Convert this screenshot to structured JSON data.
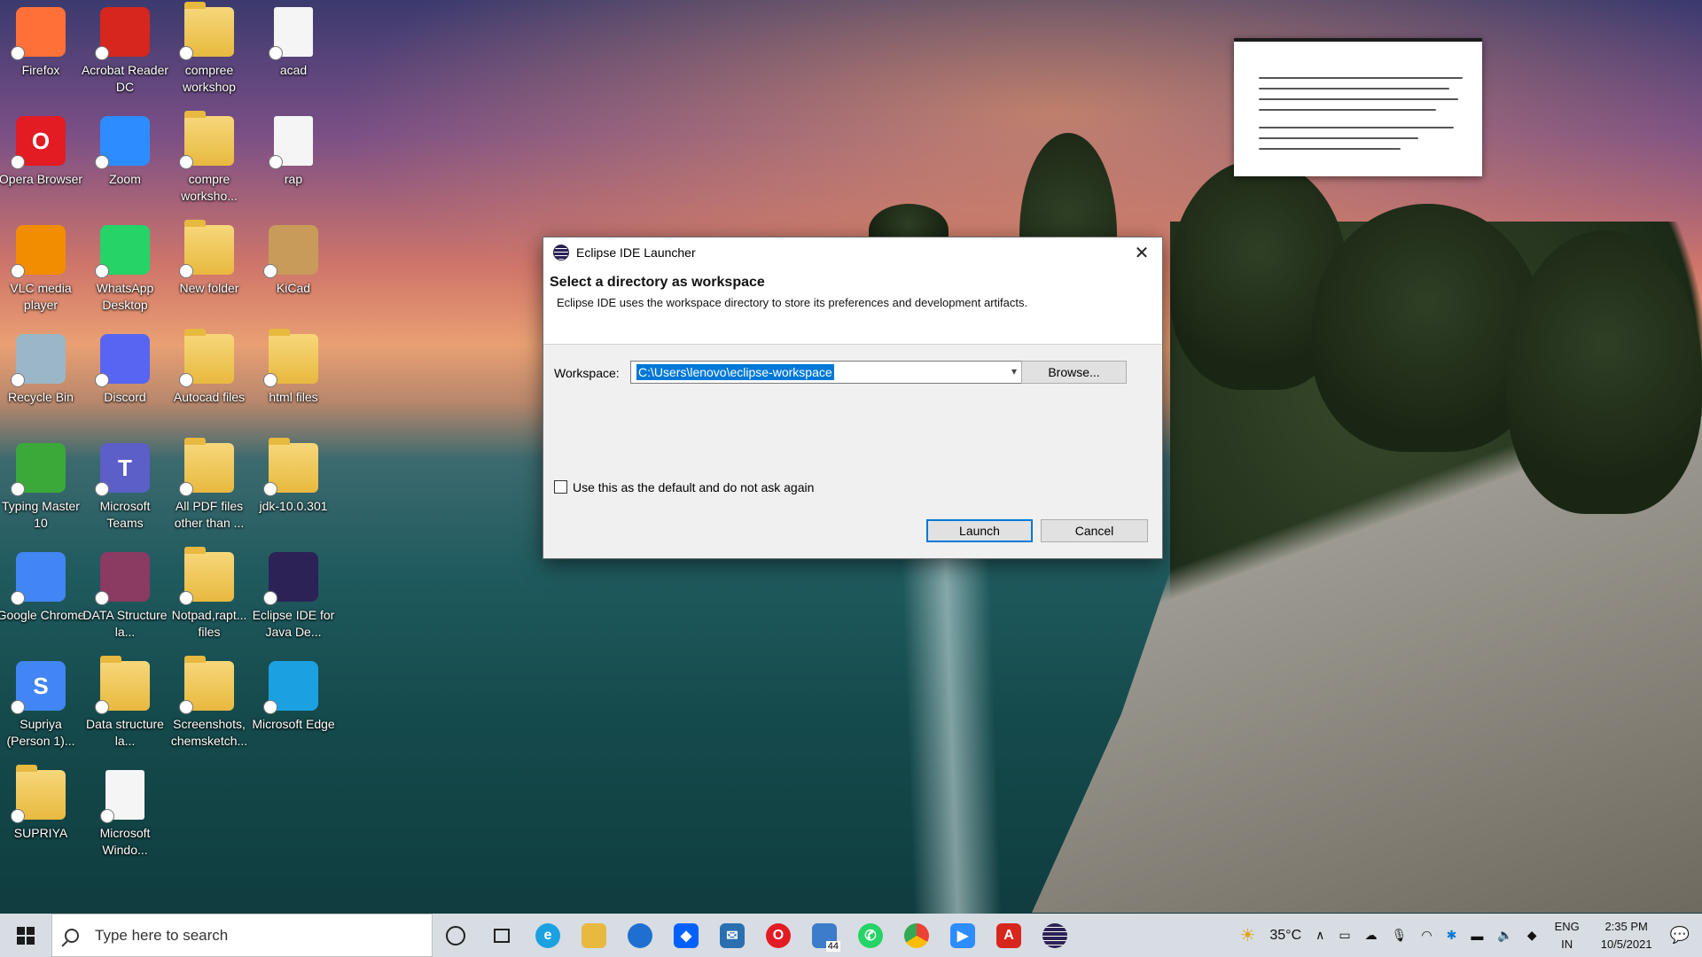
{
  "desktop": {
    "icons": [
      {
        "label": "Firefox",
        "glyph": "",
        "color": "#ff7139"
      },
      {
        "label": "Acrobat Reader DC",
        "glyph": "",
        "color": "#d7261e"
      },
      {
        "label": "compree workshop",
        "glyph": "",
        "color": "folder"
      },
      {
        "label": "acad",
        "glyph": "",
        "color": "doc"
      },
      {
        "label": "Opera Browser",
        "glyph": "O",
        "color": "#e31b23"
      },
      {
        "label": "Zoom",
        "glyph": "",
        "color": "#2d8cff"
      },
      {
        "label": "compre worksho...",
        "glyph": "",
        "color": "folder"
      },
      {
        "label": "rap",
        "glyph": "",
        "color": "doc"
      },
      {
        "label": "VLC media player",
        "glyph": "",
        "color": "#f28c00"
      },
      {
        "label": "WhatsApp Desktop",
        "glyph": "",
        "color": "#25d366"
      },
      {
        "label": "New folder",
        "glyph": "",
        "color": "folder"
      },
      {
        "label": "KiCad",
        "glyph": "",
        "color": "#c89b5a"
      },
      {
        "label": "Recycle Bin",
        "glyph": "",
        "color": "#9bb7c7"
      },
      {
        "label": "Discord",
        "glyph": "",
        "color": "#5865f2"
      },
      {
        "label": "Autocad files",
        "glyph": "",
        "color": "folder"
      },
      {
        "label": "html files",
        "glyph": "",
        "color": "folder"
      },
      {
        "label": "Typing Master 10",
        "glyph": "",
        "color": "#3aa93a"
      },
      {
        "label": "Microsoft Teams",
        "glyph": "T",
        "color": "#5b5fc7"
      },
      {
        "label": "All PDF files other than ...",
        "glyph": "",
        "color": "folder"
      },
      {
        "label": "jdk-10.0.301",
        "glyph": "",
        "color": "folder"
      },
      {
        "label": "Google Chrome",
        "glyph": "",
        "color": "#4285f4"
      },
      {
        "label": "DATA Structure la...",
        "glyph": "",
        "color": "#8b3a62"
      },
      {
        "label": "Notpad,rapt... files",
        "glyph": "",
        "color": "folder"
      },
      {
        "label": "Eclipse IDE for Java De...",
        "glyph": "",
        "color": "#2c2255"
      },
      {
        "label": "Supriya (Person 1)...",
        "glyph": "S",
        "color": "#4285f4"
      },
      {
        "label": "Data structure la...",
        "glyph": "",
        "color": "folder"
      },
      {
        "label": "Screenshots, chemsketch...",
        "glyph": "",
        "color": "folder"
      },
      {
        "label": "Microsoft Edge",
        "glyph": "",
        "color": "#1ba1e2"
      },
      {
        "label": "SUPRIYA",
        "glyph": "",
        "color": "folder"
      },
      {
        "label": "Microsoft Windo...",
        "glyph": "",
        "color": "doc"
      }
    ]
  },
  "dialog": {
    "title": "Eclipse IDE Launcher",
    "heading": "Select a directory as workspace",
    "description": "Eclipse IDE uses the workspace directory to store its preferences and development artifacts.",
    "workspace_label": "Workspace:",
    "workspace_value": "C:\\Users\\lenovo\\eclipse-workspace",
    "browse_label": "Browse...",
    "checkbox_label": "Use this as the default and do not ask again",
    "launch_label": "Launch",
    "cancel_label": "Cancel"
  },
  "taskbar": {
    "search_placeholder": "Type here to search",
    "weather": "35°C",
    "language": "ENG",
    "region": "IN",
    "time": "2:35 PM",
    "date": "10/5/2021",
    "mail_badge": "44"
  },
  "colors": {
    "accent": "#0078d7",
    "taskbar_bg": "#d7dde3",
    "dialog_bg": "#f0f0f0"
  }
}
